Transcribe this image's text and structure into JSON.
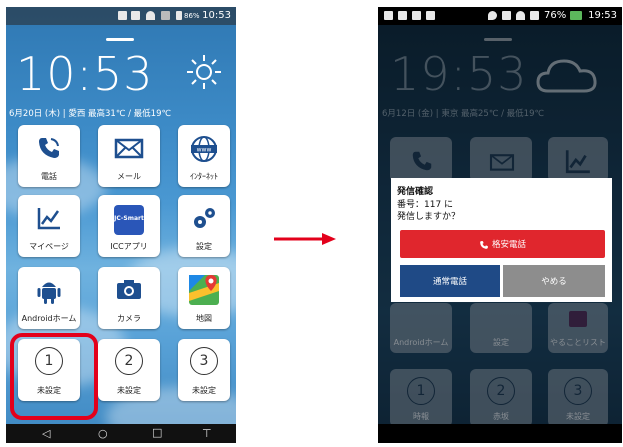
{
  "left_screen": {
    "status": {
      "battery": "86%",
      "time": "10:53"
    },
    "clock": "10:53",
    "date_line": "6月20日 (木) | 愛西 最高31℃ / 最低19℃",
    "tiles": [
      {
        "label": "電話",
        "icon": "phone-icon"
      },
      {
        "label": "メール",
        "icon": "mail-icon"
      },
      {
        "label": "ｲﾝﾀｰﾈｯﾄ",
        "icon": "globe-www-icon"
      },
      {
        "label": "マイページ",
        "icon": "chart-icon"
      },
      {
        "label": "ICCアプリ",
        "icon": "jc-smart-icon"
      },
      {
        "label": "設定",
        "icon": "gears-icon"
      },
      {
        "label": "Androidホーム",
        "icon": "android-icon"
      },
      {
        "label": "カメラ",
        "icon": "camera-icon"
      },
      {
        "label": "地図",
        "icon": "map-icon"
      },
      {
        "label": "未設定",
        "number": "1"
      },
      {
        "label": "未設定",
        "number": "2"
      },
      {
        "label": "未設定",
        "number": "3"
      }
    ],
    "jc_smart_text": "JC-Smart",
    "www_text": "www"
  },
  "right_screen": {
    "status": {
      "battery": "76%",
      "time": "19:53"
    },
    "clock": "19:53",
    "date_line": "6月12日 (金) | 東京 最高25℃ / 最低19℃",
    "tiles_visible": [
      {
        "label": "Androidホーム"
      },
      {
        "label": "設定"
      },
      {
        "label": "やることリスト"
      },
      {
        "label": "時報",
        "number": "1"
      },
      {
        "label": "赤坂",
        "number": "2"
      },
      {
        "label": "未設定",
        "number": "3"
      }
    ],
    "dialog": {
      "title": "発信確認",
      "line1": "番号：117 に",
      "line2": "発信しますか？",
      "cheap_call": "格安電話",
      "normal_call": "通常電話",
      "cancel": "やめる"
    }
  },
  "colors": {
    "highlight": "#e3001b",
    "arrow": "#e3001b",
    "cheap_button": "#e0262d",
    "normal_button": "#1f4a86",
    "cancel_button": "#8d8d8d"
  }
}
